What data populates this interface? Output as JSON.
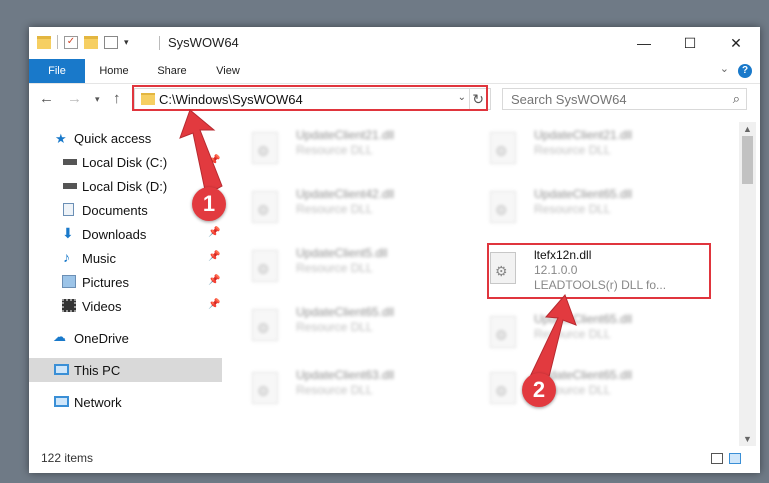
{
  "window": {
    "title": "SysWOW64"
  },
  "controls": {
    "minimize": "—",
    "maximize": "☐",
    "close": "✕"
  },
  "ribbon": {
    "tabs": [
      "File",
      "Home",
      "Share",
      "View"
    ],
    "help": "?"
  },
  "address": {
    "path": "C:\\Windows\\SysWOW64"
  },
  "search": {
    "placeholder": "Search SysWOW64"
  },
  "sidebar": {
    "items": [
      {
        "label": "Quick access",
        "icon": "star-icon"
      },
      {
        "label": "Local Disk (C:)",
        "icon": "drive-icon",
        "pinned": true
      },
      {
        "label": "Local Disk (D:)",
        "icon": "drive-icon",
        "pinned": false
      },
      {
        "label": "Documents",
        "icon": "documents-icon",
        "pinned": true
      },
      {
        "label": "Downloads",
        "icon": "downloads-icon",
        "pinned": true
      },
      {
        "label": "Music",
        "icon": "music-icon",
        "pinned": true
      },
      {
        "label": "Pictures",
        "icon": "pictures-icon",
        "pinned": true
      },
      {
        "label": "Videos",
        "icon": "videos-icon",
        "pinned": true
      },
      {
        "label": "OneDrive",
        "icon": "onedrive-icon"
      },
      {
        "label": "This PC",
        "icon": "pc-icon",
        "selected": true
      },
      {
        "label": "Network",
        "icon": "network-icon"
      }
    ]
  },
  "files": [
    {
      "name": "UpdateClient21.dll",
      "type": "Resource DLL"
    },
    {
      "name": "UpdateClient21.dll",
      "type": "Resource DLL"
    },
    {
      "name": "UpdateClient42.dll",
      "type": "Resource DLL"
    },
    {
      "name": "UpdateClient65.dll",
      "type": "Resource DLL"
    },
    {
      "name": "UpdateClient5.dll",
      "type": "Resource DLL"
    },
    {
      "name": "ltefx12n.dll",
      "version": "12.1.0.0",
      "description": "LEADTOOLS(r) DLL fo..."
    },
    {
      "name": "UpdateClient65.dll",
      "type": "Resource DLL"
    },
    {
      "name": "UpdateClient65.dll",
      "type": "Resource DLL"
    },
    {
      "name": "UpdateClient63.dll",
      "type": "Resource DLL"
    },
    {
      "name": "UpdateClient65.dll",
      "type": "Resource DLL"
    }
  ],
  "status": {
    "item_count": "122 items"
  },
  "annotations": {
    "badge1": "1",
    "badge2": "2"
  },
  "colors": {
    "accent": "#1979ca",
    "highlight": "#e0353d"
  }
}
